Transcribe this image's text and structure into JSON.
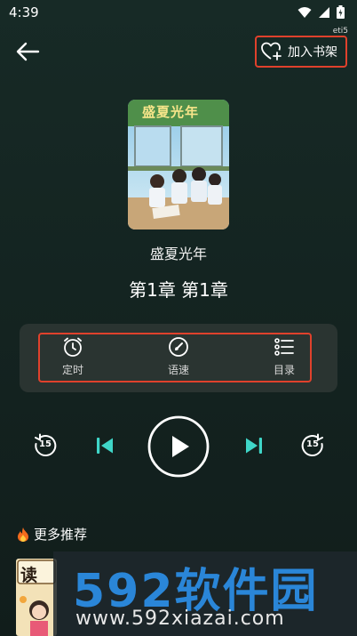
{
  "status_bar": {
    "time": "4:39",
    "carrier": "eti5"
  },
  "header": {
    "add_to_shelf_label": "加入书架"
  },
  "book": {
    "cover_title": "盛夏光年",
    "title": "盛夏光年",
    "chapter": "第1章 第1章"
  },
  "tools": [
    {
      "label": "定时",
      "icon": "timer-icon"
    },
    {
      "label": "语速",
      "icon": "speed-icon"
    },
    {
      "label": "目录",
      "icon": "list-icon"
    }
  ],
  "player": {
    "rewind_seconds": "15",
    "forward_seconds": "15"
  },
  "recommend": {
    "title": "更多推荐",
    "thumb_text": "读"
  },
  "watermark": {
    "logo": "592软件园",
    "url": "www.592xiazai.com"
  },
  "colors": {
    "accent": "#3fd6c8",
    "highlight": "#e0412c",
    "panel": "#2a3431"
  }
}
